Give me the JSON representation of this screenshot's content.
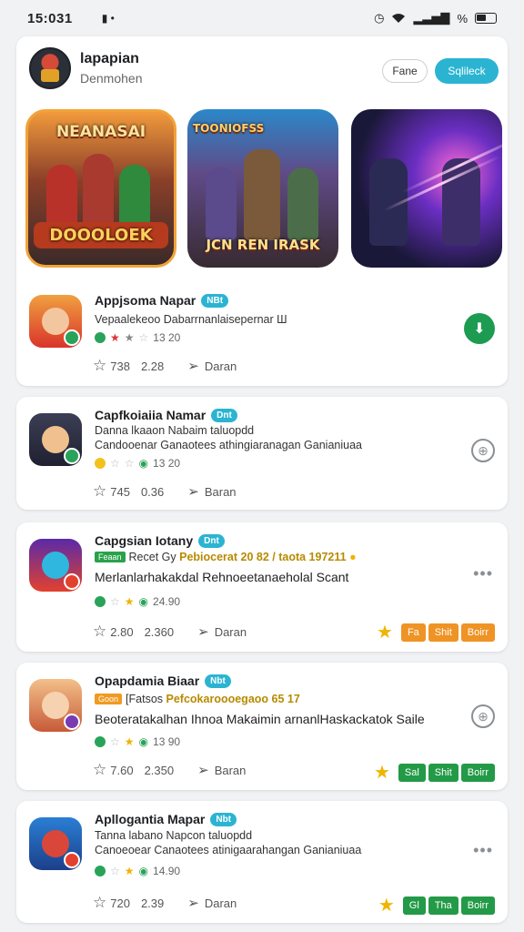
{
  "status_bar": {
    "time": "15:031",
    "sim_icon": "sim-card-icon",
    "percent": "%"
  },
  "header": {
    "title": "lapapian",
    "subtitle": "Denmohen",
    "btn_outline": "Fane",
    "btn_filled": "Sqlileck"
  },
  "banners": [
    {
      "top_text": "NEANASAI",
      "bottom_text": "DOOOLOEK"
    },
    {
      "top_text": "TOONIOFSS",
      "bottom_text": "JCN REN IRASK"
    },
    {
      "top_text": "",
      "bottom_text": ""
    }
  ],
  "apps": [
    {
      "name": "Appjsoma Napar",
      "tag": "NBt",
      "desc": "Vepaalekeoo Dabarrnanlaisepernar Ш",
      "rating_text": "13 20",
      "stat1": "738",
      "stat2": "2.28",
      "share": "Daran",
      "right_icon": "download-icon"
    },
    {
      "name": "Capfkoiaiia Namar",
      "tag": "Dnt",
      "desc": "Danna lkaaon Nabaim taluopdd",
      "desc_line2": "Candooenar Ganaotees athingiaranagan Ganianiuaa",
      "rating_text": "13 20",
      "stat1": "745",
      "stat2": "0.36",
      "share": "Baran",
      "right_icon": "refresh-icon"
    },
    {
      "name": "Capgsian Iotany",
      "tag": "Dnt",
      "chip": "Feaan",
      "promo_prefix": "Recet Gy",
      "promo": "Pebiocerat 20 82 / taota 197211",
      "desc2": "Merlanlarhakakdal Rehnoeetanaeholal Scant",
      "rating_text": "24.90",
      "stat1": "2.80",
      "stat2": "2.360",
      "share": "Daran",
      "pills": [
        "Fa",
        "Shit",
        "Boirr"
      ]
    },
    {
      "name": "Opapdamia Biaar",
      "tag": "Nbt",
      "chip": "Goon",
      "promo_prefix": "[Fatsos",
      "promo": "Pefcokaroooegaoo 65 17",
      "desc2": "Beoteratakalhan Ihnoa Makaimin arnanlHaskackatok Saile",
      "rating_text": "13 90",
      "stat1": "7.60",
      "stat2": "2.350",
      "share": "Baran",
      "right_icon": "refresh-icon",
      "pills": [
        "Sal",
        "Shit",
        "Boirr"
      ]
    },
    {
      "name": "Apllogantia Mapar",
      "tag": "Nbt",
      "desc": "Tanna labano Napcon taluopdd",
      "desc_line2": "Canoeoear Canaotees atinigaarahangan Ganianiuaa",
      "rating_text": "14.90",
      "stat1": "720",
      "stat2": "2.39",
      "share": "Daran",
      "pills": [
        "Gl",
        "Tha",
        "Boirr"
      ]
    }
  ],
  "colors": {
    "accent": "#2bb4d2",
    "green": "#239a47",
    "orange": "#ef9325",
    "star": "#f0b400"
  }
}
